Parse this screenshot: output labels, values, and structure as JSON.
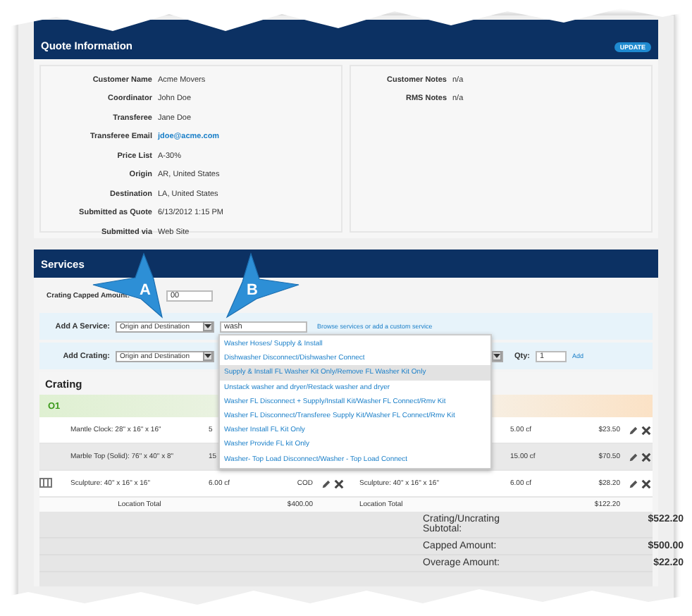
{
  "quote_info": {
    "title": "Quote Information",
    "update_button": "UPDATE",
    "fields": [
      {
        "label": "Customer Name",
        "value": "Acme Movers",
        "kind": "text"
      },
      {
        "label": "Coordinator",
        "value": "John Doe",
        "kind": "text"
      },
      {
        "label": "Transferee",
        "value": "Jane Doe",
        "kind": "text"
      },
      {
        "label": "Transferee Email",
        "value": "jdoe@acme.com",
        "kind": "link"
      },
      {
        "label": "Price List",
        "value": "A-30%",
        "kind": "text"
      },
      {
        "label": "Origin",
        "value": "AR, United States",
        "kind": "text"
      },
      {
        "label": "Destination",
        "value": "LA, United States",
        "kind": "text"
      },
      {
        "label": "Submitted as Quote",
        "value": "6/13/2012 1:15 PM",
        "kind": "text"
      },
      {
        "label": "Submitted via",
        "value": "Web Site",
        "kind": "text"
      }
    ],
    "notes": [
      {
        "label": "Customer Notes",
        "value": "n/a"
      },
      {
        "label": "RMS Notes",
        "value": "n/a"
      }
    ]
  },
  "services": {
    "title": "Services",
    "capped_amount": {
      "label": "Crating Capped Amount:",
      "value": "00"
    },
    "add_service": {
      "label": "Add A Service:",
      "select": "Origin and Destination",
      "search": "wash",
      "link": "Browse services or add a custom service"
    },
    "suggestions": [
      {
        "text": "Washer Hoses/ Supply & Install",
        "selected": false
      },
      {
        "text": "Dishwasher Disconnect/Dishwasher Connect",
        "selected": false
      },
      {
        "text": "Supply & Install FL Washer Kit Only/Remove FL Washer Kit Only",
        "selected": true
      },
      {
        "text": "Unstack washer and dryer/Restack washer and dryer",
        "selected": false
      },
      {
        "text": "Washer FL Disconnect + Supply/Install Kit/Washer FL Connect/Rmv Kit",
        "selected": false
      },
      {
        "text": "Washer FL Disconnect/Transferee Supply Kit/Washer FL Connect/Rmv Kit",
        "selected": false
      },
      {
        "text": "Washer Install FL Kit Only",
        "selected": false
      },
      {
        "text": "Washer Provide FL kit Only",
        "selected": false
      },
      {
        "text": "Washer- Top Load Disconnect/Washer - Top Load Connect",
        "selected": false
      }
    ],
    "add_crating": {
      "label": "Add Crating:",
      "select": "Origin and Destination",
      "qty_label": "Qty:",
      "qty": "1",
      "add_link": "Add"
    },
    "crating": {
      "title": "Crating",
      "location": "O1",
      "rows": [
        {
          "icon": false,
          "description": "Mantle Clock: 28\" x 16\" x 16\"",
          "quantity": "5",
          "actions_left": false,
          "volume": "5.00 cf",
          "price": "$23.50",
          "actions_right": true
        },
        {
          "icon": false,
          "description": "Marble Top (Solid): 76\" x 40\" x 8\"",
          "quantity": "15",
          "actions_left": false,
          "volume": "15.00 cf",
          "price": "$70.50",
          "actions_right": true
        },
        {
          "icon": true,
          "description": "Sculpture: 40\" x 16\" x 16\"",
          "quantity": "6.00 cf",
          "type": "COD",
          "actions_left": true,
          "description_2": "Sculpture: 40\" x 16\" x 16\"",
          "volume": "6.00 cf",
          "price": "$28.20",
          "actions_right": true
        }
      ],
      "totals": {
        "label": "Location Total",
        "value": "$400.00",
        "label_2": "Location Total",
        "value_2": "$122.20"
      },
      "summary": [
        {
          "label": "Crating/Uncrating Subtotal:",
          "value": "$522.20"
        },
        {
          "label": "Capped Amount:",
          "value": "$500.00"
        },
        {
          "label": "Overage Amount:",
          "value": "$22.20"
        }
      ]
    }
  },
  "callouts": [
    {
      "label": "A"
    },
    {
      "label": "B"
    }
  ]
}
